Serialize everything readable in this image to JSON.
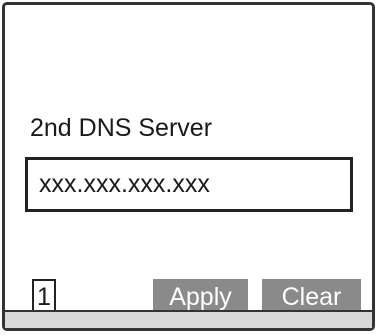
{
  "screen": {
    "field_label": "2nd DNS Server",
    "ip_value": "xxx.xxx.xxx.xxx",
    "page_number": "1"
  },
  "buttons": {
    "apply_label": "Apply",
    "clear_label": "Clear"
  },
  "colors": {
    "button_bg": "#8a8a8a",
    "button_text": "#ffffff",
    "border": "#222222",
    "bottom_bar": "#d9d9d9"
  }
}
